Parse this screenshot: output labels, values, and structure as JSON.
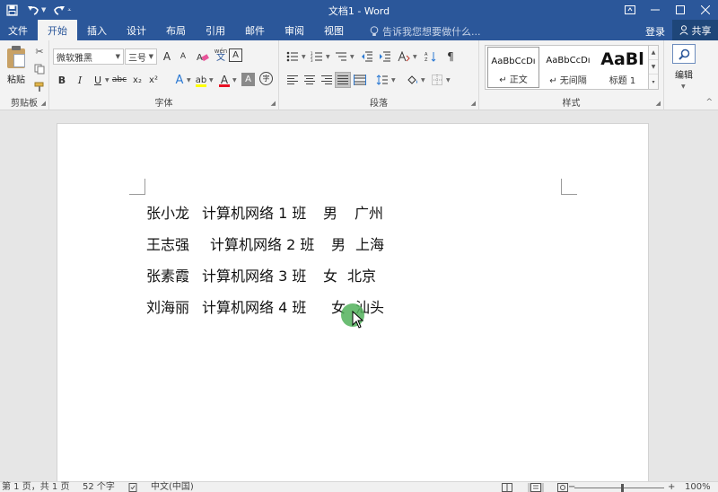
{
  "window": {
    "title": "文档1 - Word"
  },
  "tabs": [
    {
      "label": "文件"
    },
    {
      "label": "开始"
    },
    {
      "label": "插入"
    },
    {
      "label": "设计"
    },
    {
      "label": "布局"
    },
    {
      "label": "引用"
    },
    {
      "label": "邮件"
    },
    {
      "label": "审阅"
    },
    {
      "label": "视图"
    }
  ],
  "active_tab": "开始",
  "tellme": {
    "placeholder": "告诉我您想要做什么..."
  },
  "account": {
    "login": "登录",
    "share": "共享"
  },
  "ribbon": {
    "clipboard": {
      "label": "剪贴板",
      "paste": "粘贴"
    },
    "font": {
      "label": "字体",
      "font_name": "微软雅黑",
      "font_size": "三号",
      "phonetic_top": "wén",
      "phonetic_bottom": "文",
      "border_char": "A",
      "enclose_char": "字",
      "grow": "A",
      "shrink": "A",
      "bold": "B",
      "italic": "I",
      "underline": "U",
      "strike": "abc",
      "subscript": "x₂",
      "superscript": "x²",
      "effects": "A",
      "highlight": "ab",
      "font_color": "A",
      "shade_char": "A"
    },
    "paragraph": {
      "label": "段落"
    },
    "styles": {
      "label": "样式",
      "items": [
        {
          "sample": "AaBbCcDı",
          "name": "↵ 正文"
        },
        {
          "sample": "AaBbCcDı",
          "name": "↵ 无间隔"
        },
        {
          "sample": "AaBl",
          "name": "标题 1"
        }
      ]
    },
    "editing": {
      "label": "编辑"
    }
  },
  "document": {
    "rows": [
      [
        "张小龙",
        "计算机网络 1 班",
        "男",
        "广州"
      ],
      [
        "王志强",
        "计算机网络 2 班",
        "男",
        "上海"
      ],
      [
        "张素霞",
        "计算机网络 3 班",
        "女",
        "北京"
      ],
      [
        "刘海丽",
        "计算机网络 4 班",
        "女",
        "汕头"
      ]
    ]
  },
  "statusbar": {
    "page": "第 1 页，共 1 页",
    "words": "52 个字",
    "language": "中文(中国)",
    "zoom": "100%"
  },
  "colors": {
    "brand": "#2b579a",
    "highlight": "#ffff00",
    "font_color": "#e81123",
    "cursor": "#52b25c"
  }
}
